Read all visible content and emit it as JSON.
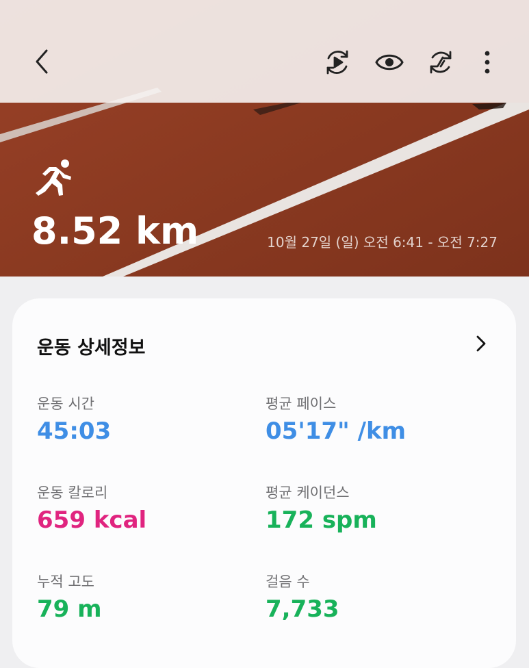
{
  "header": {
    "icons": {
      "back": "chevron-left-icon",
      "replay": "route-replay-icon",
      "view": "eye-icon",
      "sync": "sync-icon",
      "more": "more-vertical-icon"
    }
  },
  "hero": {
    "activity_icon": "running-person-icon",
    "distance": "8.52 km",
    "time_range": "10월 27일 (일) 오전 6:41 - 오전 7:27"
  },
  "details": {
    "title": "운동 상세정보",
    "stats": [
      {
        "label": "운동 시간",
        "value": "45:03",
        "unit": "",
        "color": "#3f8ee5"
      },
      {
        "label": "평균 페이스",
        "value": "05'17\"",
        "unit": " /km",
        "color": "#3f8ee5"
      },
      {
        "label": "운동 칼로리",
        "value": "659",
        "unit": " kcal",
        "color": "#e0247f"
      },
      {
        "label": "평균 케이던스",
        "value": "172",
        "unit": " spm",
        "color": "#18b25a"
      },
      {
        "label": "누적 고도",
        "value": "79",
        "unit": " m",
        "color": "#18b25a"
      },
      {
        "label": "걸음 수",
        "value": "7,733",
        "unit": "",
        "color": "#18b25a"
      }
    ]
  },
  "colors": {
    "track": "#8e3b22",
    "accent_blue": "#3f8ee5",
    "accent_pink": "#e0247f",
    "accent_green": "#18b25a"
  }
}
